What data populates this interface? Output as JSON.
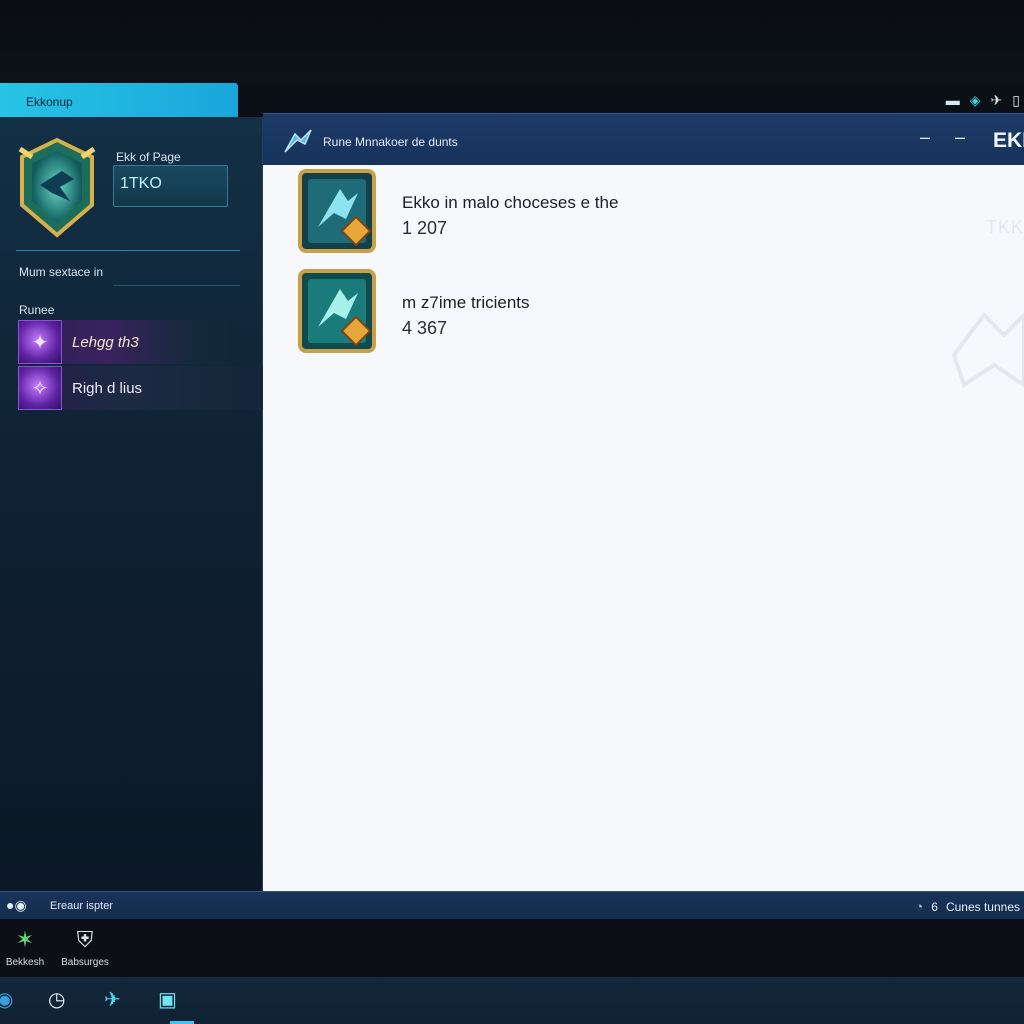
{
  "left_window": {
    "tab_title": "Ekkonup",
    "page_label": "Ekk of Page",
    "page_name": "1TKO",
    "section_label": "Mum sextace in",
    "runes_label": "Runee",
    "runes": [
      {
        "label": "Lehgg th3",
        "icon": "rune-icon"
      },
      {
        "label": "Righ d lius",
        "icon": "rune-icon"
      }
    ]
  },
  "main_window": {
    "title": "Rune Mnnakoer de dunts",
    "brand": "EKK",
    "min1": "–",
    "min2": "–",
    "watermark": "TKK",
    "entries": [
      {
        "title": "Ekko in malo choceses e the",
        "value": "1 207"
      },
      {
        "title": "m z7ime tricients",
        "value": "4 367"
      }
    ]
  },
  "status_bar": {
    "left_text": "Ereaur ispter",
    "right_number": "6",
    "right_text": "Cunes tunnes"
  },
  "dock": [
    {
      "label": "Bekkesh",
      "icon": "ekko-icon"
    },
    {
      "label": "Babsurges",
      "icon": "shield-icon"
    }
  ],
  "colors": {
    "accent": "#27c4e6",
    "panel": "#133046",
    "header": "#1c3a66",
    "rune": "#8e52d8"
  }
}
